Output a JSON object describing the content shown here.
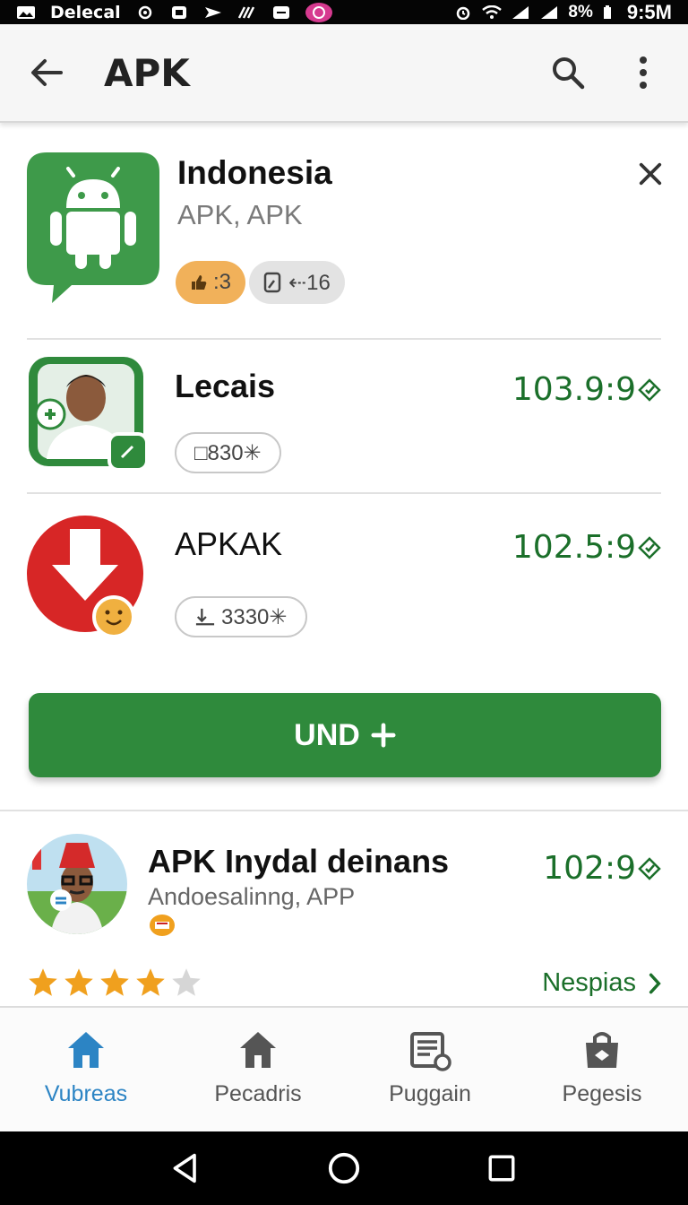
{
  "status_bar": {
    "carrier": "Delecal",
    "battery_text": "8%",
    "clock": "9:5M"
  },
  "app_bar": {
    "title": "APK",
    "icons": [
      "back-arrow-icon",
      "search-icon",
      "more-vert-icon"
    ]
  },
  "featured": {
    "name": "Indonesia",
    "subtitle": "APK, APK",
    "chip_1": ":3",
    "chip_2": "⇠16",
    "brand_color": "#3e9a4a"
  },
  "items": [
    {
      "name": "Lecais",
      "pill": "□830✳",
      "price": "103.9:9"
    },
    {
      "name": "APKAK",
      "pill": "3330✳",
      "price": "102.5:9"
    }
  ],
  "cta": {
    "label": "UND"
  },
  "big_item": {
    "name": "APK Inydal deinans",
    "subtitle": "Andoesalinng, APP",
    "price": "102:9",
    "rating": 4,
    "rating_max": 5,
    "more_label": "Nespias"
  },
  "bottom_nav": [
    {
      "label": "Vubreas",
      "icon": "home-icon",
      "active": true
    },
    {
      "label": "Pecadris",
      "icon": "home-icon",
      "active": false
    },
    {
      "label": "Puggain",
      "icon": "receipt-icon",
      "active": false
    },
    {
      "label": "Pegesis",
      "icon": "bag-icon",
      "active": false
    }
  ],
  "colors": {
    "accent_green": "#2f8a3c",
    "price_green": "#1b6f2a",
    "nav_active": "#2c84c4",
    "star": "#f0a01e"
  }
}
